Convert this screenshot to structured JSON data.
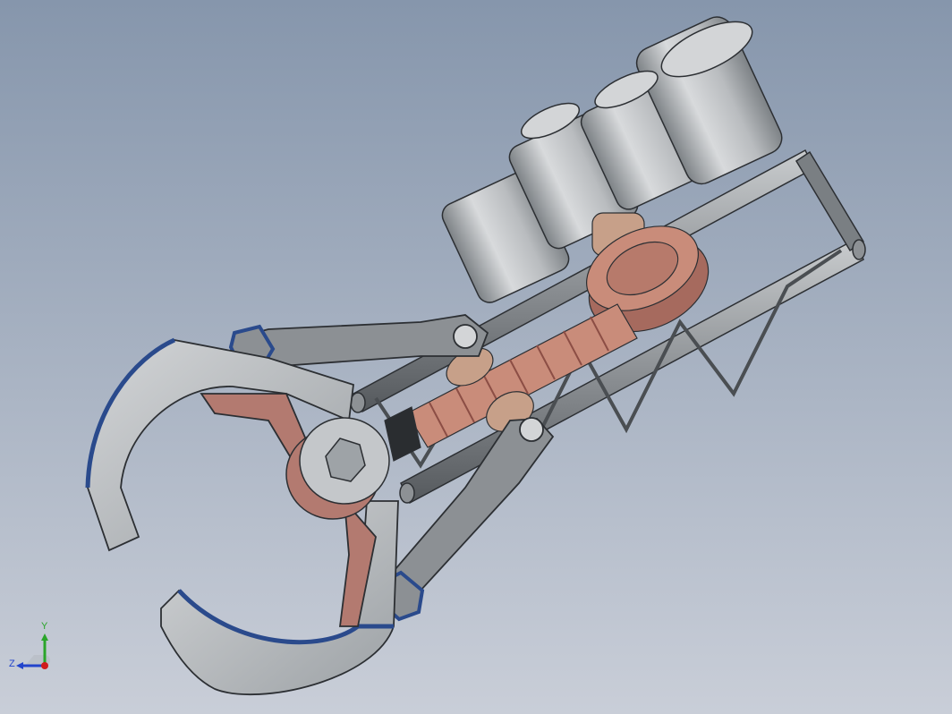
{
  "viewport": {
    "background_top": "#8696ac",
    "background_bottom": "#c9ced8"
  },
  "model": {
    "colors": {
      "metal_light": "#c4c7ca",
      "metal_mid": "#9ea3a7",
      "metal_dark": "#55595d",
      "edge": "#2c2f33",
      "blue_edge": "#2a4a8c",
      "copper": "#c98c7a",
      "copper_dark": "#8c4e45",
      "bronze": "#c7a089"
    }
  },
  "triad": {
    "y_label": "Y",
    "z_label": "Z",
    "y_color": "#2aa52a",
    "z_color": "#2244cc",
    "origin_color": "#d01c1c"
  }
}
